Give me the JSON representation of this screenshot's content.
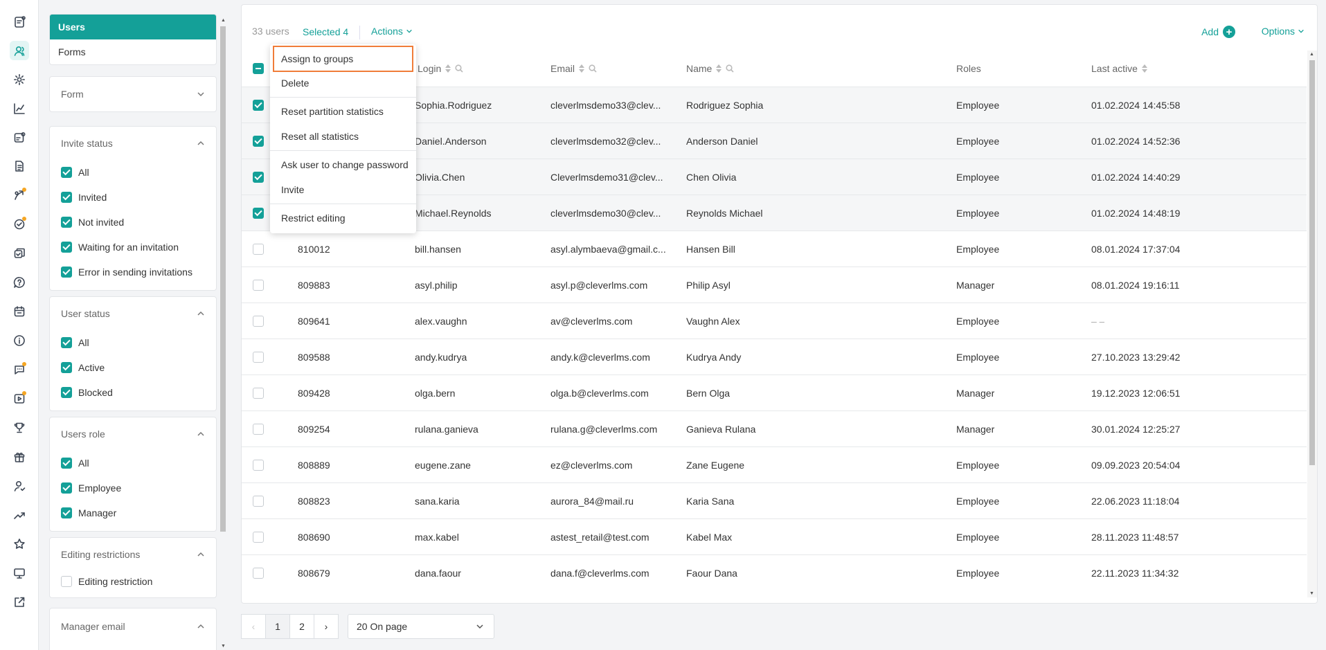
{
  "rail": [
    "reports-icon",
    "users-icon",
    "settings-icon",
    "chart-icon",
    "tasks-icon",
    "documents-icon",
    "skills-icon",
    "checklist-icon",
    "courses-icon",
    "help-icon",
    "calendar-icon",
    "info-icon",
    "chat-icon",
    "video-icon",
    "trophy-icon",
    "gift-icon",
    "user-check-icon",
    "trend-icon",
    "star-icon",
    "monitor-icon",
    "external-link-icon"
  ],
  "nav": {
    "users": "Users",
    "forms": "Forms"
  },
  "filters": {
    "form": {
      "title": "Form"
    },
    "invite_status": {
      "title": "Invite status",
      "options": [
        "All",
        "Invited",
        "Not invited",
        "Waiting for an invitation",
        "Error in sending invitations"
      ]
    },
    "user_status": {
      "title": "User status",
      "options": [
        "All",
        "Active",
        "Blocked"
      ]
    },
    "users_role": {
      "title": "Users role",
      "options": [
        "All",
        "Employee",
        "Manager"
      ]
    },
    "editing_restrictions": {
      "title": "Editing restrictions",
      "options": [
        "Editing restriction"
      ]
    },
    "manager_email": {
      "title": "Manager email"
    }
  },
  "toolbar": {
    "count": "33 users",
    "selected": "Selected 4",
    "actions": "Actions",
    "add": "Add",
    "options": "Options"
  },
  "columns": {
    "login": "Login",
    "email": "Email",
    "name": "Name",
    "roles": "Roles",
    "last_active": "Last active"
  },
  "rows": [
    {
      "id": "",
      "login": "Sophia.Rodriguez",
      "email": "cleverlmsdemo33@clev...",
      "name": "Rodriguez Sophia",
      "role": "Employee",
      "last": "01.02.2024 14:45:58",
      "checked": true
    },
    {
      "id": "",
      "login": "Daniel.Anderson",
      "email": "cleverlmsdemo32@clev...",
      "name": "Anderson Daniel",
      "role": "Employee",
      "last": "01.02.2024 14:52:36",
      "checked": true
    },
    {
      "id": "",
      "login": "Olivia.Chen",
      "email": "Cleverlmsdemo31@clev...",
      "name": "Chen Olivia",
      "role": "Employee",
      "last": "01.02.2024 14:40:29",
      "checked": true
    },
    {
      "id": "",
      "login": "Michael.Reynolds",
      "email": "cleverlmsdemo30@clev...",
      "name": "Reynolds Michael",
      "role": "Employee",
      "last": "01.02.2024 14:48:19",
      "checked": true
    },
    {
      "id": "810012",
      "login": "bill.hansen",
      "email": "asyl.alymbaeva@gmail.c...",
      "name": "Hansen Bill",
      "role": "Employee",
      "last": "08.01.2024 17:37:04",
      "checked": false
    },
    {
      "id": "809883",
      "login": "asyl.philip",
      "email": "asyl.p@cleverlms.com",
      "name": "Philip Asyl",
      "role": "Manager",
      "last": "08.01.2024 19:16:11",
      "checked": false
    },
    {
      "id": "809641",
      "login": "alex.vaughn",
      "email": "av@cleverlms.com",
      "name": "Vaughn Alex",
      "role": "Employee",
      "last": "– –",
      "checked": false
    },
    {
      "id": "809588",
      "login": "andy.kudrya",
      "email": "andy.k@cleverlms.com",
      "name": "Kudrya Andy",
      "role": "Employee",
      "last": "27.10.2023 13:29:42",
      "checked": false
    },
    {
      "id": "809428",
      "login": "olga.bern",
      "email": "olga.b@cleverlms.com",
      "name": "Bern Olga",
      "role": "Manager",
      "last": "19.12.2023 12:06:51",
      "checked": false
    },
    {
      "id": "809254",
      "login": "rulana.ganieva",
      "email": "rulana.g@cleverlms.com",
      "name": "Ganieva Rulana",
      "role": "Manager",
      "last": "30.01.2024 12:25:27",
      "checked": false
    },
    {
      "id": "808889",
      "login": "eugene.zane",
      "email": "ez@cleverlms.com",
      "name": "Zane Eugene",
      "role": "Employee",
      "last": "09.09.2023 20:54:04",
      "checked": false
    },
    {
      "id": "808823",
      "login": "sana.karia",
      "email": "aurora_84@mail.ru",
      "name": "Karia Sana",
      "role": "Employee",
      "last": "22.06.2023 11:18:04",
      "checked": false
    },
    {
      "id": "808690",
      "login": "max.kabel",
      "email": "astest_retail@test.com",
      "name": "Kabel Max",
      "role": "Employee",
      "last": "28.11.2023 11:48:57",
      "checked": false
    },
    {
      "id": "808679",
      "login": "dana.faour",
      "email": "dana.f@cleverlms.com",
      "name": "Faour Dana",
      "role": "Employee",
      "last": "22.11.2023 11:34:32",
      "checked": false
    }
  ],
  "actions_menu": [
    {
      "label": "Assign to groups",
      "highlight": true
    },
    {
      "label": "Delete"
    },
    {
      "sep": true
    },
    {
      "label": "Reset partition statistics"
    },
    {
      "label": "Reset all statistics"
    },
    {
      "sep": true
    },
    {
      "label": "Ask user to change password"
    },
    {
      "label": "Invite"
    },
    {
      "sep": true
    },
    {
      "label": "Restrict editing"
    }
  ],
  "pagination": {
    "prev": "‹",
    "pages": [
      "1",
      "2"
    ],
    "next": "›",
    "per_page": "20 On page"
  }
}
